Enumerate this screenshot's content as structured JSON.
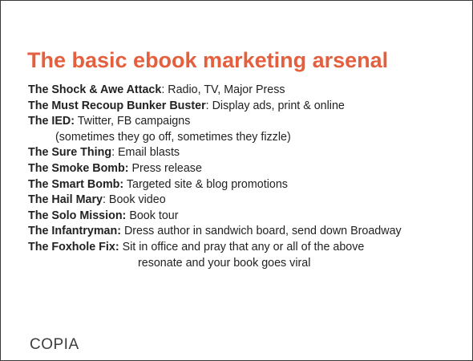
{
  "slide": {
    "title": "The basic ebook marketing arsenal",
    "items": [
      {
        "term": "The Shock & Awe Attack",
        "sep": ": ",
        "desc": "Radio, TV, Major Press"
      },
      {
        "term": "The Must Recoup Bunker Buster",
        "sep": ": ",
        "desc": "Display ads, print & online"
      },
      {
        "term": "The IED:",
        "sep": " ",
        "desc": "Twitter, FB campaigns",
        "note": "(sometimes they go off, sometimes they fizzle)"
      },
      {
        "term": "The Sure Thing",
        "sep": ": ",
        "desc": "Email blasts"
      },
      {
        "term": "The Smoke Bomb:",
        "sep": " ",
        "desc": "Press release"
      },
      {
        "term": "The Smart Bomb:",
        "sep": " ",
        "desc": "Targeted site & blog promotions"
      },
      {
        "term": "The Hail Mary",
        "sep": ": ",
        "desc": "Book video"
      },
      {
        "term": "The Solo Mission:",
        "sep": " ",
        "desc": "Book tour"
      },
      {
        "term": "The Infantryman:",
        "sep": " ",
        "desc": "Dress author in sandwich board, send down Broadway"
      },
      {
        "term": "The Foxhole Fix:",
        "sep": " ",
        "desc": "Sit in office and pray that any or all of the above",
        "continuation": "resonate and your book goes viral"
      }
    ],
    "logo_text": "COPIA",
    "title_color": "#e45f3d"
  }
}
